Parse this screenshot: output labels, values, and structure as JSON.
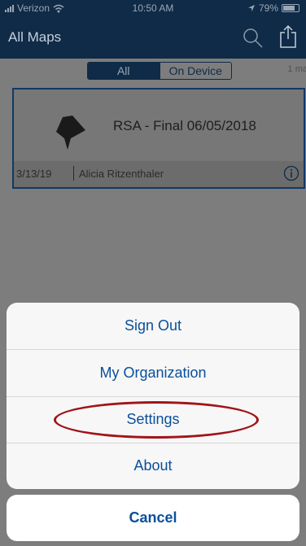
{
  "status_bar": {
    "carrier": "Verizon",
    "time": "10:50 AM",
    "battery": "79%",
    "battery_level": 0.79
  },
  "navbar": {
    "title": "All Maps",
    "search_icon": "search-icon",
    "share_icon": "share-icon"
  },
  "segments": {
    "all_label": "All",
    "device_label": "On Device",
    "selected": "All",
    "count_text": "1 ma"
  },
  "map_item": {
    "title": "RSA - Final 06/05/2018",
    "date": "3/13/19",
    "owner": "Alicia Ritzenthaler",
    "thumbnail_icon": "map-thumbnail",
    "info_icon": "info-icon"
  },
  "action_sheet": {
    "items": [
      "Sign Out",
      "My Organization",
      "Settings",
      "About"
    ],
    "cancel": "Cancel",
    "highlighted": "Settings"
  },
  "colors": {
    "navbar": "#0f2b47",
    "action_text": "#0a4f9c",
    "highlight_ring": "#a01418"
  }
}
